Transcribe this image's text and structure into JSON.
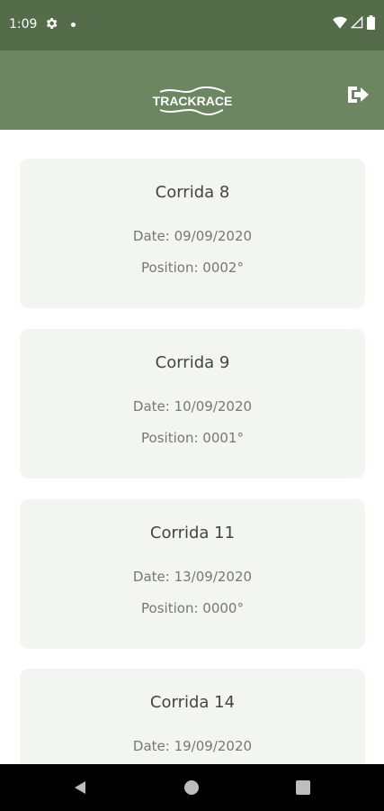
{
  "status_bar": {
    "time": "1:09",
    "icons": [
      "settings-gear-icon",
      "notification-dot-icon",
      "wifi-icon",
      "signal-icon",
      "battery-icon"
    ]
  },
  "app_bar": {
    "logo_text": "TRACKRACE",
    "logout_icon": "logout-icon"
  },
  "races": [
    {
      "title": "Corrida 8",
      "date": "Date: 09/09/2020",
      "position": "Position: 0002°"
    },
    {
      "title": "Corrida 9",
      "date": "Date: 10/09/2020",
      "position": "Position: 0001°"
    },
    {
      "title": "Corrida 11",
      "date": "Date: 13/09/2020",
      "position": "Position: 0000°"
    },
    {
      "title": "Corrida 14",
      "date": "Date: 19/09/2020",
      "position": ""
    }
  ],
  "nav_bar": {
    "icons": [
      "back-icon",
      "home-icon",
      "recents-icon"
    ]
  },
  "colors": {
    "status_bar": "#556c4b",
    "app_bar": "#6b8661",
    "card_bg": "#f3f5f2",
    "title_text": "#444444",
    "meta_text": "#777777"
  }
}
